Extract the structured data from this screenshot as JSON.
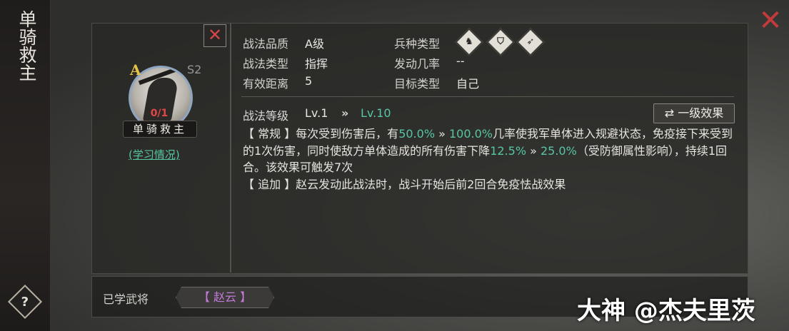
{
  "side_title": "单骑救主",
  "help_label": "?",
  "close_glyph": "✕",
  "card": {
    "close_glyph": "✕",
    "grade": "A",
    "season": "S2",
    "count": "0/1",
    "name": "单骑救主",
    "learn_link": "(学习情况)"
  },
  "info": {
    "quality_label": "战法品质",
    "quality_value": "A级",
    "troop_label": "兵种类型",
    "type_label": "战法类型",
    "type_value": "指挥",
    "rate_label": "发动几率",
    "rate_value": "--",
    "range_label": "有效距离",
    "range_value": "5",
    "target_label": "目标类型",
    "target_value": "自己",
    "troop_icons": [
      "cavalry-icon",
      "shield-icon",
      "bow-icon"
    ]
  },
  "level": {
    "label": "战法等级",
    "current": "Lv.1",
    "arrow": "»",
    "max": "Lv.10",
    "effect_button": "⇄ 一级效果"
  },
  "effect": {
    "line1_a": "【 常规 】每次受到伤害后，有",
    "pct1": "50.0%",
    "arrow1": " » ",
    "pct2": "100.0%",
    "line1_b": "几率使我军单体进入规避状态，免疫接下来受到的1次伤害，同时使敌方单体造成的所有伤害下降",
    "pct3": "12.5%",
    "arrow2": " » ",
    "pct4": "25.0%",
    "line1_c": "（受防御属性影响），持续1回合。该效果可触发7次",
    "line2": "【 追加 】赵云发动此战法时，战斗开始后前2回合免疫怯战效果"
  },
  "bottom": {
    "label": "已学武将",
    "general": "【 赵云 】"
  },
  "watermark": "大神 @杰夫里茨",
  "colors": {
    "highlight": "#57c6a4",
    "grade": "#e3c14a",
    "close": "#c23b3b",
    "general": "#c27bd8"
  }
}
